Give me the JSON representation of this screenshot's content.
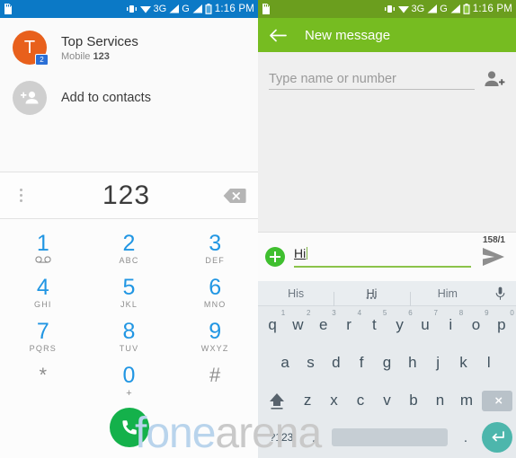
{
  "left": {
    "statusbar": {
      "icons": [
        "sd-card-icon",
        "vibrate-icon",
        "wifi-icon",
        "signal-3g-icon",
        "signal-g-icon",
        "battery-icon"
      ],
      "network_3g": "3G",
      "network_g": "G",
      "time": "1:16 PM"
    },
    "contact": {
      "avatar_letter": "T",
      "badge": "2",
      "name": "Top Services",
      "sub_label": "Mobile",
      "sub_number": "123"
    },
    "add_to_contacts": {
      "label": "Add to contacts",
      "icon": "add-person-icon"
    },
    "dialer": {
      "number": "123",
      "overflow_icon": "overflow-menu-icon",
      "backspace_icon": "backspace-icon",
      "call_icon": "phone-call-icon",
      "keys": [
        {
          "num": "1",
          "sub": "",
          "sub_icon": "voicemail-icon"
        },
        {
          "num": "2",
          "sub": "ABC"
        },
        {
          "num": "3",
          "sub": "DEF"
        },
        {
          "num": "4",
          "sub": "GHI"
        },
        {
          "num": "5",
          "sub": "JKL"
        },
        {
          "num": "6",
          "sub": "MNO"
        },
        {
          "num": "7",
          "sub": "PQRS"
        },
        {
          "num": "8",
          "sub": "TUV"
        },
        {
          "num": "9",
          "sub": "WXYZ"
        },
        {
          "num": "*",
          "sub": ""
        },
        {
          "num": "0",
          "sub": "+"
        },
        {
          "num": "#",
          "sub": ""
        }
      ]
    }
  },
  "right": {
    "statusbar": {
      "network_3g": "3G",
      "network_g": "G",
      "time": "1:16 PM"
    },
    "header": {
      "back_icon": "back-arrow-icon",
      "title": "New message"
    },
    "recipient": {
      "placeholder": "Type name or number",
      "add_contact_icon": "add-contact-icon"
    },
    "composer": {
      "counter": "158/1",
      "attach_icon": "plus-icon",
      "message": "Hi",
      "send_icon": "send-icon"
    },
    "keyboard": {
      "suggestions": [
        "His",
        "Hi",
        "Him"
      ],
      "active_suggestion": "Hi",
      "mic_icon": "microphone-icon",
      "row1": [
        {
          "key": "q",
          "hint": "1"
        },
        {
          "key": "w",
          "hint": "2"
        },
        {
          "key": "e",
          "hint": "3"
        },
        {
          "key": "r",
          "hint": "4"
        },
        {
          "key": "t",
          "hint": "5"
        },
        {
          "key": "y",
          "hint": "6"
        },
        {
          "key": "u",
          "hint": "7"
        },
        {
          "key": "i",
          "hint": "8"
        },
        {
          "key": "o",
          "hint": "9"
        },
        {
          "key": "p",
          "hint": "0"
        }
      ],
      "row2": [
        "a",
        "s",
        "d",
        "f",
        "g",
        "h",
        "j",
        "k",
        "l"
      ],
      "row3": [
        "z",
        "x",
        "c",
        "v",
        "b",
        "n",
        "m"
      ],
      "shift_icon": "shift-icon",
      "backspace_icon": "backspace-icon",
      "symbols_key": "?123",
      "comma_key": ",",
      "period_key": ".",
      "space_key": "",
      "enter_icon": "enter-icon"
    }
  },
  "watermark": {
    "part1": "fone",
    "part2": "arena"
  },
  "colors": {
    "status_blue": "#0b79c6",
    "status_green": "#6b9e1e",
    "header_green": "#76bc21",
    "dial_blue": "#2196e3",
    "call_green": "#14b14b",
    "avatar_orange": "#e8601c",
    "enter_teal": "#4db6ac",
    "plus_green": "#3fbf2f"
  }
}
